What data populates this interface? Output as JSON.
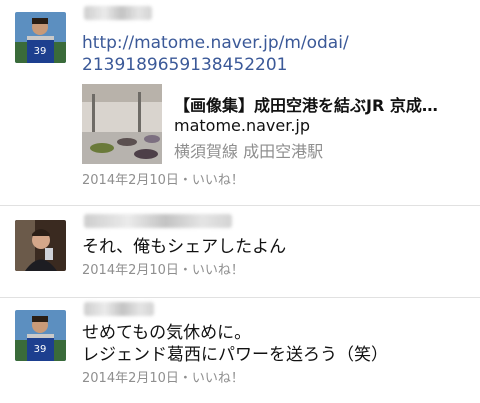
{
  "comments": [
    {
      "avatar_icon": "player-photo-avatar",
      "text_lines": [
        "http://matome.naver.jp/m/odai/",
        "2139189659138452201"
      ],
      "preview": {
        "thumbnail_icon": "airport-terminal-photo",
        "title": "【画像集】成田空港を結ぶJR 京成…",
        "domain": "matome.naver.jp",
        "description": "横須賀線 成田空港駅"
      },
      "date": "2014年2月10日",
      "separator": "・",
      "like_label": "いいね！"
    },
    {
      "avatar_icon": "selfie-photo-avatar",
      "text_lines": [
        "それ、俺もシェアしたよん"
      ],
      "date": "2014年2月10日",
      "separator": "・",
      "like_label": "いいね！"
    },
    {
      "avatar_icon": "player-photo-avatar",
      "text_lines": [
        "せめてもの気休めに。",
        "レジェンド葛西にパワーを送ろう（笑）"
      ],
      "date": "2014年2月10日",
      "separator": "・",
      "like_label": "いいね！"
    }
  ],
  "colors": {
    "link": "#3b5998",
    "meta": "#8f8f8f",
    "divider": "#e1e1e1"
  }
}
